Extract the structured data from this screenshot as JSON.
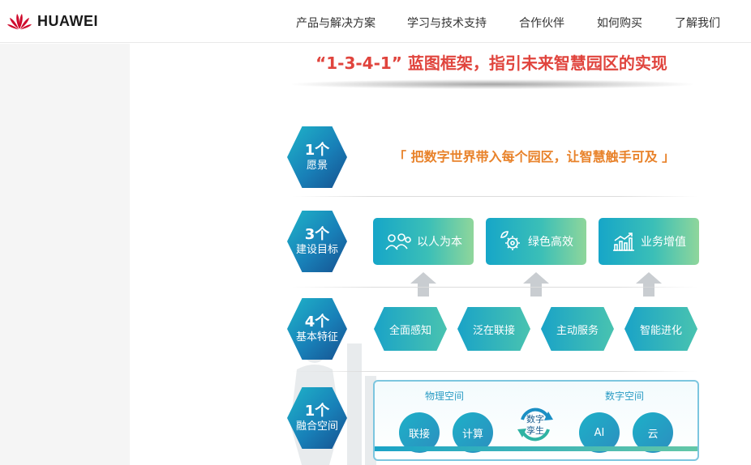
{
  "header": {
    "brand": "HUAWEI",
    "nav": [
      {
        "label": "产品与解决方案"
      },
      {
        "label": "学习与技术支持"
      },
      {
        "label": "合作伙伴"
      },
      {
        "label": "如何购买"
      },
      {
        "label": "了解我们"
      }
    ]
  },
  "figure": {
    "title": "“1-3-4-1” 蓝图框架，指引未来智慧园区的实现",
    "vision": {
      "num": "1个",
      "label": "愿景",
      "statement": "「 把数字世界带入每个园区，让智慧触手可及 」"
    },
    "goals": {
      "num": "3个",
      "label": "建设目标",
      "items": [
        {
          "label": "以人为本",
          "icon": "people-icon"
        },
        {
          "label": "绿色高效",
          "icon": "gear-leaf-icon"
        },
        {
          "label": "业务增值",
          "icon": "growth-chart-icon"
        }
      ]
    },
    "features": {
      "num": "4个",
      "label": "基本特征",
      "items": [
        {
          "label": "全面感知"
        },
        {
          "label": "泛在联接"
        },
        {
          "label": "主动服务"
        },
        {
          "label": "智能进化"
        }
      ]
    },
    "fusion": {
      "num": "1个",
      "label": "融合空间",
      "physical": {
        "title": "物理空间",
        "items": [
          "联接",
          "计算"
        ]
      },
      "twin": {
        "line1": "数字",
        "line2": "孪生"
      },
      "digital": {
        "title": "数字空间",
        "items": [
          "AI",
          "云"
        ]
      }
    }
  },
  "colors": {
    "title_red": "#e0443d",
    "vision_orange": "#e8822a",
    "teal": "#1fb4c9",
    "blue": "#1880b8"
  }
}
